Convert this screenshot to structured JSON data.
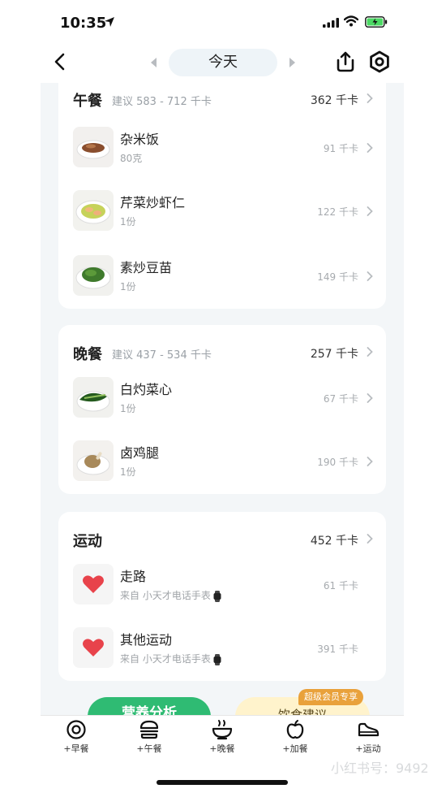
{
  "status_bar": {
    "time": "10:35"
  },
  "nav": {
    "title": "今天"
  },
  "lunch": {
    "title": "午餐",
    "hint": "建议 583 - 712 千卡",
    "total": "362 千卡",
    "items": [
      {
        "name": "杂米饭",
        "amount": "80克",
        "kcal": "91 千卡"
      },
      {
        "name": "芹菜炒虾仁",
        "amount": "1份",
        "kcal": "122 千卡"
      },
      {
        "name": "素炒豆苗",
        "amount": "1份",
        "kcal": "149 千卡"
      }
    ]
  },
  "dinner": {
    "title": "晚餐",
    "hint": "建议 437 - 534 千卡",
    "total": "257 千卡",
    "items": [
      {
        "name": "白灼菜心",
        "amount": "1份",
        "kcal": "67 千卡"
      },
      {
        "name": "卤鸡腿",
        "amount": "1份",
        "kcal": "190 千卡"
      }
    ]
  },
  "exercise": {
    "title": "运动",
    "total": "452 千卡",
    "items": [
      {
        "name": "走路",
        "source": "来自 小天才电话手表",
        "kcal": "61 千卡"
      },
      {
        "name": "其他运动",
        "source": "来自 小天才电话手表",
        "kcal": "391 千卡"
      }
    ]
  },
  "actions": {
    "analysis_label": "营养分析",
    "advice_label": "饮食建议",
    "vip_badge": "超级会员专享"
  },
  "tabs": [
    {
      "label": "+早餐",
      "icon": "breakfast-icon"
    },
    {
      "label": "+午餐",
      "icon": "burger-icon"
    },
    {
      "label": "+晚餐",
      "icon": "bowl-icon"
    },
    {
      "label": "+加餐",
      "icon": "apple-icon"
    },
    {
      "label": "+运动",
      "icon": "shoe-icon"
    }
  ],
  "watermark": "小红书号：9492",
  "colors": {
    "accent_green": "#2fbb73",
    "vip_orange": "#e9a13b",
    "heart_red": "#e8434b"
  }
}
